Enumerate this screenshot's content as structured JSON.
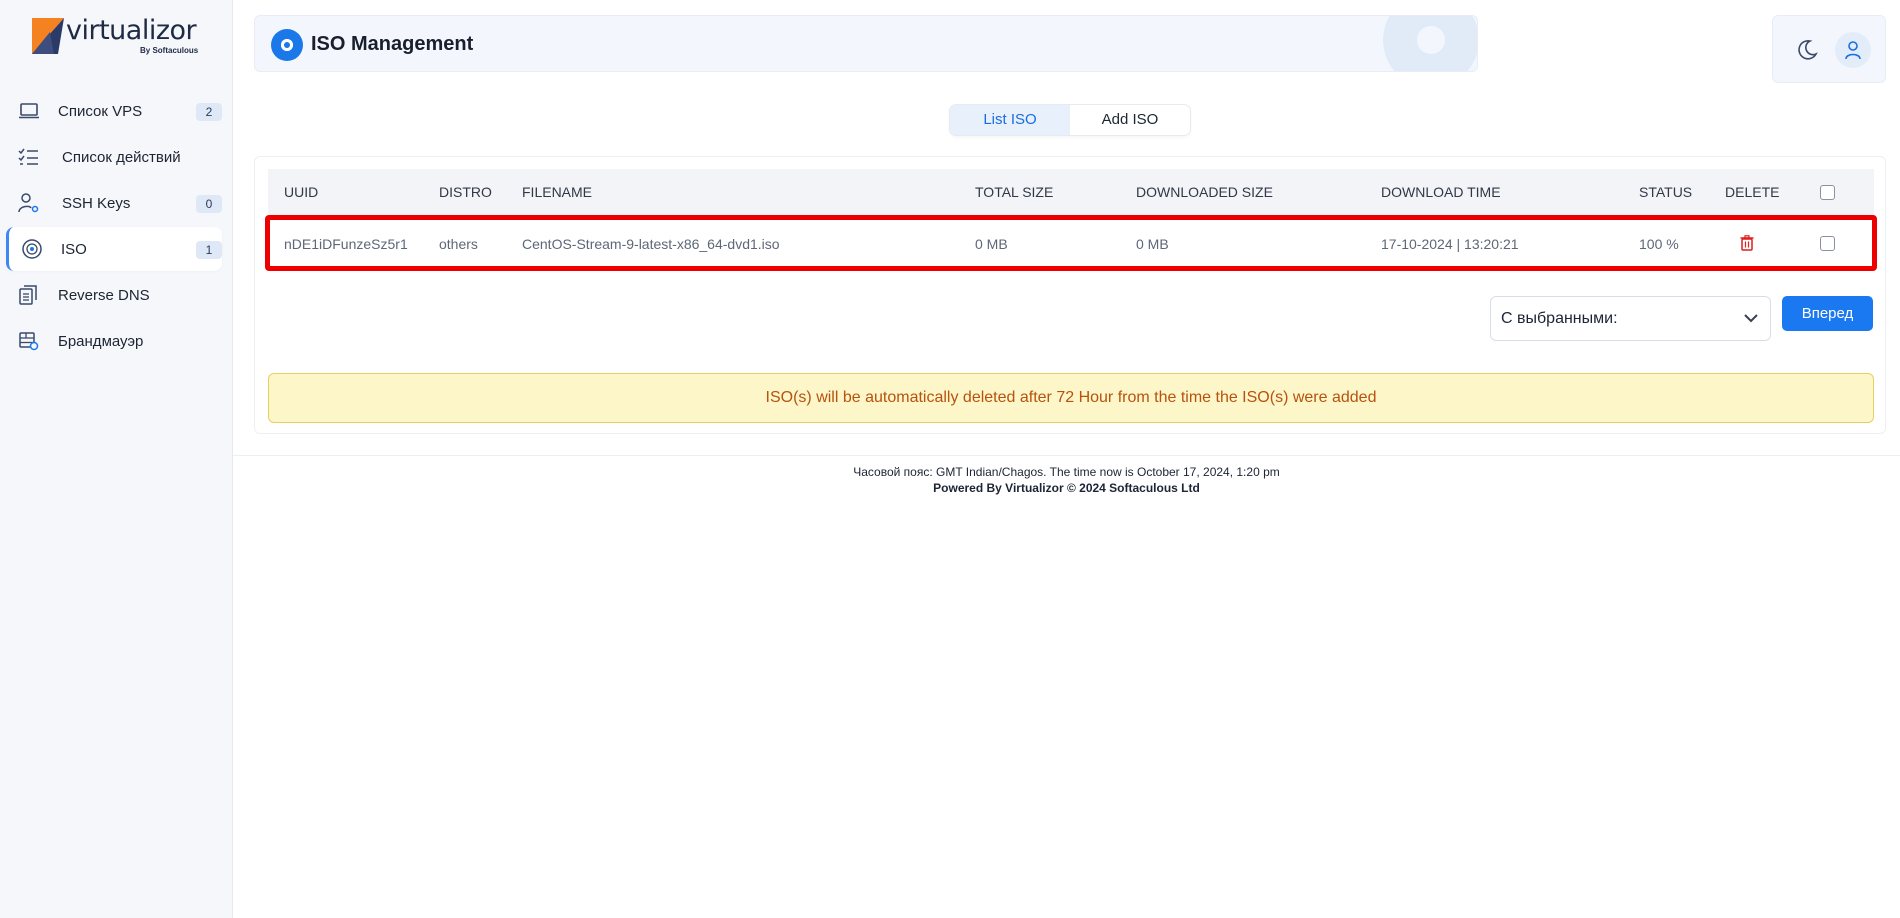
{
  "brand": {
    "name": "virtualizor",
    "sub": "By Softaculous"
  },
  "sidebar": {
    "items": [
      {
        "label": "Список VPS",
        "badge": "2"
      },
      {
        "label": "Список действий",
        "badge": ""
      },
      {
        "label": "SSH Keys",
        "badge": "0"
      },
      {
        "label": "ISO",
        "badge": "1"
      },
      {
        "label": "Reverse DNS",
        "badge": ""
      },
      {
        "label": "Брандмауэр",
        "badge": ""
      }
    ]
  },
  "header": {
    "title": "ISO Management"
  },
  "tabs": [
    {
      "label": "List ISO"
    },
    {
      "label": "Add ISO"
    }
  ],
  "table": {
    "columns": [
      "UUID",
      "DISTRO",
      "FILENAME",
      "TOTAL SIZE",
      "DOWNLOADED SIZE",
      "DOWNLOAD TIME",
      "STATUS",
      "DELETE"
    ],
    "rows": [
      {
        "uuid": "nDE1iDFunzeSz5r1",
        "distro": "others",
        "filename": "CentOS-Stream-9-latest-x86_64-dvd1.iso",
        "total_size": "0 MB",
        "downloaded_size": "0 MB",
        "download_time": "17-10-2024 | 13:20:21",
        "status": "100 %"
      }
    ]
  },
  "bulk": {
    "selected_label": "С выбранными:",
    "go_label": "Вперед"
  },
  "alert": {
    "text": "ISO(s) will be automatically deleted after 72 Hour from the time the ISO(s) were added"
  },
  "footer": {
    "timezone": "Часовой пояс: GMT Indian/Chagos. The time now is October 17, 2024, 1:20 pm",
    "powered": "Powered By Virtualizor © 2024 Softaculous Ltd"
  },
  "colors": {
    "accent": "#1a78f0",
    "highlight": "#ee0000",
    "alert_bg": "#fdf6c9",
    "alert_text": "#b7520f"
  }
}
